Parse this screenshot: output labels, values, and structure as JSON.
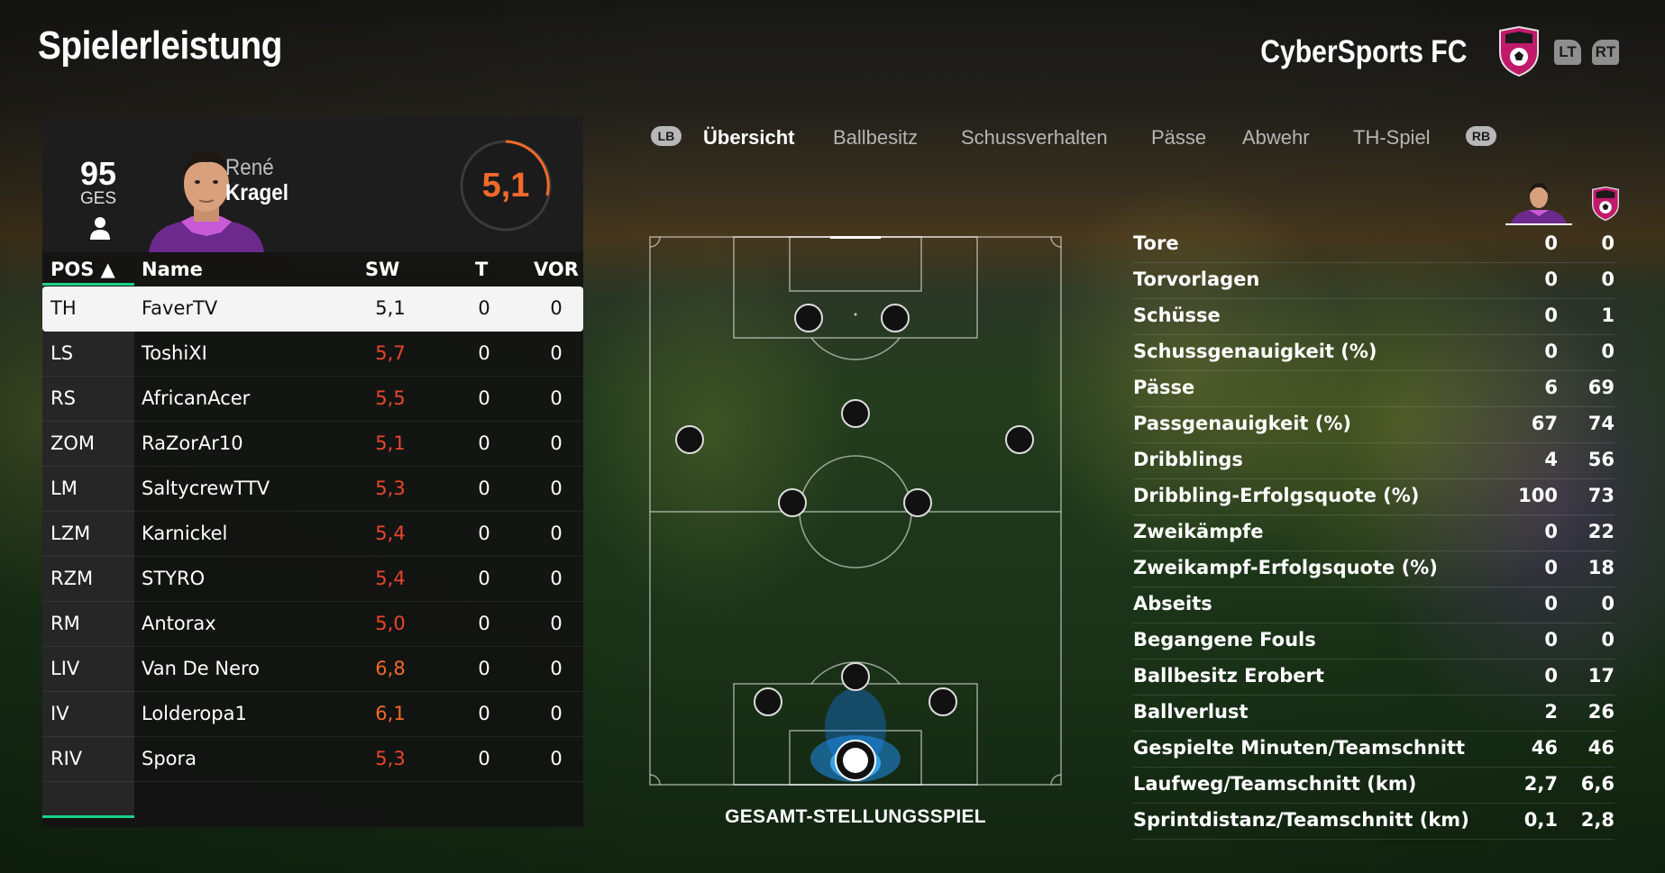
{
  "header": {
    "title": "Spielerleistung",
    "team_name": "CyberSports FC",
    "lt_label": "LT",
    "rt_label": "RT"
  },
  "player_card": {
    "overall": "95",
    "overall_label": "GES",
    "first_name": "René",
    "last_name": "Kragel",
    "match_rating": "5,1"
  },
  "table": {
    "headers": {
      "pos": "POS ▲",
      "name": "Name",
      "sw": "SW",
      "t": "T",
      "vor": "VOR"
    },
    "rows": [
      {
        "pos": "TH",
        "name": "FaverTV",
        "sw": "5,1",
        "t": "0",
        "vor": "0",
        "selected": true
      },
      {
        "pos": "LS",
        "name": "ToshiXI",
        "sw": "5,7",
        "t": "0",
        "vor": "0"
      },
      {
        "pos": "RS",
        "name": "AfricanAcer",
        "sw": "5,5",
        "t": "0",
        "vor": "0"
      },
      {
        "pos": "ZOM",
        "name": "RaZorAr10",
        "sw": "5,1",
        "t": "0",
        "vor": "0"
      },
      {
        "pos": "LM",
        "name": "SaltycrewTTV",
        "sw": "5,3",
        "t": "0",
        "vor": "0"
      },
      {
        "pos": "LZM",
        "name": "Karnickel",
        "sw": "5,4",
        "t": "0",
        "vor": "0"
      },
      {
        "pos": "RZM",
        "name": "STYRO",
        "sw": "5,4",
        "t": "0",
        "vor": "0"
      },
      {
        "pos": "RM",
        "name": "Antorax",
        "sw": "5,0",
        "t": "0",
        "vor": "0"
      },
      {
        "pos": "LIV",
        "name": "Van De Nero",
        "sw": "6,8",
        "t": "0",
        "vor": "0"
      },
      {
        "pos": "IV",
        "name": "Lolderopa1",
        "sw": "6,1",
        "t": "0",
        "vor": "0"
      },
      {
        "pos": "RIV",
        "name": "Spora",
        "sw": "5,3",
        "t": "0",
        "vor": "0"
      }
    ]
  },
  "tabs": {
    "lb": "LB",
    "rb": "RB",
    "items": [
      "Übersicht",
      "Ballbesitz",
      "Schussverhalten",
      "Pässe",
      "Abwehr",
      "TH-Spiel"
    ],
    "active": "Übersicht"
  },
  "pitch": {
    "caption": "GESAMT-STELLUNGSSPIEL"
  },
  "stats": [
    {
      "label": "Tore",
      "player": "0",
      "team": "0"
    },
    {
      "label": "Torvorlagen",
      "player": "0",
      "team": "0"
    },
    {
      "label": "Schüsse",
      "player": "0",
      "team": "1"
    },
    {
      "label": "Schussgenauigkeit (%)",
      "player": "0",
      "team": "0"
    },
    {
      "label": "Pässe",
      "player": "6",
      "team": "69"
    },
    {
      "label": "Passgenauigkeit (%)",
      "player": "67",
      "team": "74"
    },
    {
      "label": "Dribblings",
      "player": "4",
      "team": "56"
    },
    {
      "label": "Dribbling-Erfolgsquote (%)",
      "player": "100",
      "team": "73"
    },
    {
      "label": "Zweikämpfe",
      "player": "0",
      "team": "22"
    },
    {
      "label": "Zweikampf-Erfolgsquote (%)",
      "player": "0",
      "team": "18"
    },
    {
      "label": "Abseits",
      "player": "0",
      "team": "0"
    },
    {
      "label": "Begangene Fouls",
      "player": "0",
      "team": "0"
    },
    {
      "label": "Ballbesitz Erobert",
      "player": "0",
      "team": "17"
    },
    {
      "label": "Ballverlust",
      "player": "2",
      "team": "26"
    },
    {
      "label": "Gespielte Minuten/Teamschnitt",
      "player": "46",
      "team": "46"
    },
    {
      "label": "Laufweg/Teamschnitt (km)",
      "player": "2,7",
      "team": "6,6"
    },
    {
      "label": "Sprintdistanz/Teamschnitt (km)",
      "player": "0,1",
      "team": "2,8"
    }
  ],
  "colors": {
    "rating_orange": "#f26a2a",
    "rating_red": "#e8452c",
    "accent_green": "#1ad18a",
    "crest_pink": "#c21a6b"
  }
}
